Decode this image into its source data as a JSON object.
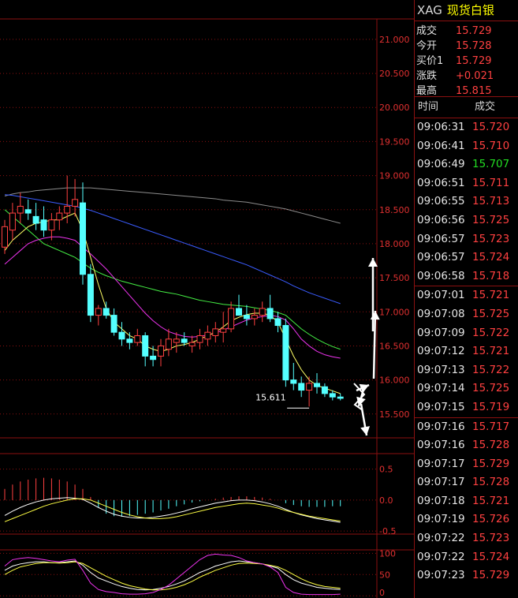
{
  "header": {
    "symbol": "XAG",
    "name": "现货白银"
  },
  "quote": [
    {
      "label": "成交",
      "value": "15.729"
    },
    {
      "label": "今开",
      "value": "15.728"
    },
    {
      "label": "买价1",
      "value": "15.729"
    },
    {
      "label": "涨跌",
      "value": "+0.021"
    },
    {
      "label": "最高",
      "value": "15.815"
    }
  ],
  "trades_header": {
    "time": "时间",
    "price": "成交"
  },
  "trades": [
    {
      "time": "09:06:31",
      "price": "15.720",
      "dir": "up"
    },
    {
      "time": "09:06:41",
      "price": "15.710",
      "dir": "up"
    },
    {
      "time": "09:06:49",
      "price": "15.707",
      "dir": "down"
    },
    {
      "time": "09:06:51",
      "price": "15.711",
      "dir": "up"
    },
    {
      "time": "09:06:55",
      "price": "15.713",
      "dir": "up"
    },
    {
      "time": "09:06:56",
      "price": "15.725",
      "dir": "up"
    },
    {
      "time": "09:06:57",
      "price": "15.723",
      "dir": "up"
    },
    {
      "time": "09:06:57",
      "price": "15.724",
      "dir": "up"
    },
    {
      "time": "09:06:58",
      "price": "15.718",
      "dir": "up"
    },
    {
      "time": "09:07:01",
      "price": "15.721",
      "dir": "up"
    },
    {
      "time": "09:07:08",
      "price": "15.725",
      "dir": "up"
    },
    {
      "time": "09:07:09",
      "price": "15.722",
      "dir": "up"
    },
    {
      "time": "09:07:12",
      "price": "15.721",
      "dir": "up"
    },
    {
      "time": "09:07:13",
      "price": "15.722",
      "dir": "up"
    },
    {
      "time": "09:07:14",
      "price": "15.725",
      "dir": "up"
    },
    {
      "time": "09:07:15",
      "price": "15.719",
      "dir": "up"
    },
    {
      "time": "09:07:16",
      "price": "15.717",
      "dir": "up"
    },
    {
      "time": "09:07:16",
      "price": "15.728",
      "dir": "up"
    },
    {
      "time": "09:07:17",
      "price": "15.729",
      "dir": "up"
    },
    {
      "time": "09:07:17",
      "price": "15.728",
      "dir": "up"
    },
    {
      "time": "09:07:18",
      "price": "15.721",
      "dir": "up"
    },
    {
      "time": "09:07:19",
      "price": "15.726",
      "dir": "up"
    },
    {
      "time": "09:07:22",
      "price": "15.723",
      "dir": "up"
    },
    {
      "time": "09:07:22",
      "price": "15.724",
      "dir": "up"
    },
    {
      "time": "09:07:23",
      "price": "15.729",
      "dir": "up"
    }
  ],
  "chart_data": {
    "type": "candlestick",
    "price_ticks": [
      "21.000",
      "20.500",
      "20.000",
      "19.500",
      "19.000",
      "18.500",
      "18.000",
      "17.500",
      "17.000",
      "16.500",
      "16.000",
      "15.500"
    ],
    "ylim": [
      15.15,
      21.3
    ],
    "low_annotation": "15.611",
    "candles": [
      {
        "o": 17.95,
        "h": 18.35,
        "l": 17.85,
        "c": 18.25
      },
      {
        "o": 18.2,
        "h": 18.6,
        "l": 18.05,
        "c": 18.45
      },
      {
        "o": 18.45,
        "h": 18.75,
        "l": 18.3,
        "c": 18.55
      },
      {
        "o": 18.5,
        "h": 18.65,
        "l": 18.35,
        "c": 18.45
      },
      {
        "o": 18.4,
        "h": 18.6,
        "l": 18.2,
        "c": 18.3
      },
      {
        "o": 18.35,
        "h": 18.55,
        "l": 18.1,
        "c": 18.2
      },
      {
        "o": 18.2,
        "h": 18.45,
        "l": 18.05,
        "c": 18.35
      },
      {
        "o": 18.35,
        "h": 18.55,
        "l": 18.2,
        "c": 18.45
      },
      {
        "o": 18.45,
        "h": 19.0,
        "l": 18.3,
        "c": 18.55
      },
      {
        "o": 18.55,
        "h": 18.95,
        "l": 18.4,
        "c": 18.65
      },
      {
        "o": 18.6,
        "h": 18.9,
        "l": 17.4,
        "c": 17.55
      },
      {
        "o": 17.55,
        "h": 17.7,
        "l": 16.85,
        "c": 16.95
      },
      {
        "o": 16.95,
        "h": 17.1,
        "l": 16.8,
        "c": 17.05
      },
      {
        "o": 17.05,
        "h": 17.15,
        "l": 16.9,
        "c": 16.95
      },
      {
        "o": 16.95,
        "h": 17.05,
        "l": 16.65,
        "c": 16.7
      },
      {
        "o": 16.7,
        "h": 16.85,
        "l": 16.5,
        "c": 16.6
      },
      {
        "o": 16.6,
        "h": 16.7,
        "l": 16.45,
        "c": 16.55
      },
      {
        "o": 16.55,
        "h": 16.75,
        "l": 16.5,
        "c": 16.65
      },
      {
        "o": 16.65,
        "h": 16.7,
        "l": 16.2,
        "c": 16.35
      },
      {
        "o": 16.35,
        "h": 16.5,
        "l": 16.2,
        "c": 16.3
      },
      {
        "o": 16.35,
        "h": 16.6,
        "l": 16.2,
        "c": 16.5
      },
      {
        "o": 16.45,
        "h": 16.75,
        "l": 16.35,
        "c": 16.6
      },
      {
        "o": 16.55,
        "h": 16.7,
        "l": 16.4,
        "c": 16.6
      },
      {
        "o": 16.6,
        "h": 16.7,
        "l": 16.5,
        "c": 16.55
      },
      {
        "o": 16.5,
        "h": 16.65,
        "l": 16.4,
        "c": 16.55
      },
      {
        "o": 16.55,
        "h": 16.75,
        "l": 16.45,
        "c": 16.65
      },
      {
        "o": 16.6,
        "h": 16.8,
        "l": 16.5,
        "c": 16.7
      },
      {
        "o": 16.65,
        "h": 16.85,
        "l": 16.55,
        "c": 16.75
      },
      {
        "o": 16.7,
        "h": 17.0,
        "l": 16.55,
        "c": 16.75
      },
      {
        "o": 16.75,
        "h": 17.15,
        "l": 16.7,
        "c": 17.05
      },
      {
        "o": 17.05,
        "h": 17.25,
        "l": 16.95,
        "c": 16.95
      },
      {
        "o": 16.95,
        "h": 17.1,
        "l": 16.8,
        "c": 16.9
      },
      {
        "o": 16.9,
        "h": 17.05,
        "l": 16.8,
        "c": 16.95
      },
      {
        "o": 16.95,
        "h": 17.15,
        "l": 16.85,
        "c": 17.05
      },
      {
        "o": 17.05,
        "h": 17.25,
        "l": 16.85,
        "c": 16.9
      },
      {
        "o": 16.9,
        "h": 17.0,
        "l": 16.7,
        "c": 16.8
      },
      {
        "o": 16.8,
        "h": 16.9,
        "l": 15.9,
        "c": 16.0
      },
      {
        "o": 16.0,
        "h": 16.25,
        "l": 15.85,
        "c": 15.95
      },
      {
        "o": 15.95,
        "h": 16.05,
        "l": 15.75,
        "c": 15.85
      },
      {
        "o": 15.85,
        "h": 16.05,
        "l": 15.61,
        "c": 15.95
      },
      {
        "o": 15.95,
        "h": 16.1,
        "l": 15.8,
        "c": 15.9
      },
      {
        "o": 15.9,
        "h": 15.95,
        "l": 15.75,
        "c": 15.8
      },
      {
        "o": 15.8,
        "h": 15.85,
        "l": 15.7,
        "c": 15.75
      },
      {
        "o": 15.75,
        "h": 15.8,
        "l": 15.7,
        "c": 15.73
      }
    ],
    "moving_averages": [
      {
        "color": "#ffffff",
        "values": [
          18.7,
          18.73,
          18.75,
          18.76,
          18.78,
          18.79,
          18.8,
          18.81,
          18.82,
          18.82,
          18.82,
          18.82,
          18.81,
          18.8,
          18.79,
          18.78,
          18.77,
          18.76,
          18.75,
          18.74,
          18.73,
          18.72,
          18.71,
          18.7,
          18.69,
          18.68,
          18.67,
          18.66,
          18.64,
          18.63,
          18.62,
          18.61,
          18.59,
          18.57,
          18.55,
          18.53,
          18.51,
          18.48,
          18.45,
          18.42,
          18.39,
          18.36,
          18.33,
          18.3
        ]
      },
      {
        "color": "#3a5cff",
        "values": [
          18.72,
          18.71,
          18.69,
          18.67,
          18.65,
          18.63,
          18.61,
          18.59,
          18.57,
          18.55,
          18.52,
          18.49,
          18.45,
          18.41,
          18.37,
          18.33,
          18.29,
          18.25,
          18.21,
          18.17,
          18.13,
          18.09,
          18.05,
          18.01,
          17.97,
          17.93,
          17.89,
          17.85,
          17.81,
          17.77,
          17.73,
          17.69,
          17.64,
          17.59,
          17.54,
          17.49,
          17.44,
          17.38,
          17.33,
          17.28,
          17.24,
          17.2,
          17.16,
          17.12
        ]
      },
      {
        "color": "#44ee44",
        "values": [
          18.5,
          18.4,
          18.3,
          18.2,
          18.1,
          18.0,
          17.95,
          17.9,
          17.85,
          17.8,
          17.72,
          17.64,
          17.58,
          17.53,
          17.49,
          17.45,
          17.42,
          17.39,
          17.36,
          17.33,
          17.3,
          17.28,
          17.26,
          17.23,
          17.2,
          17.17,
          17.15,
          17.13,
          17.11,
          17.1,
          17.09,
          17.08,
          17.06,
          17.04,
          17.02,
          16.99,
          16.95,
          16.85,
          16.75,
          16.67,
          16.6,
          16.54,
          16.49,
          16.45
        ]
      },
      {
        "color": "#ee33ee",
        "values": [
          17.7,
          17.8,
          17.9,
          18.0,
          18.05,
          18.08,
          18.1,
          18.1,
          18.08,
          18.05,
          17.95,
          17.85,
          17.74,
          17.63,
          17.5,
          17.37,
          17.24,
          17.11,
          16.98,
          16.87,
          16.78,
          16.71,
          16.67,
          16.64,
          16.63,
          16.64,
          16.66,
          16.69,
          16.73,
          16.78,
          16.83,
          16.88,
          16.91,
          16.93,
          16.95,
          16.93,
          16.88,
          16.75,
          16.6,
          16.5,
          16.42,
          16.37,
          16.34,
          16.32
        ]
      },
      {
        "color": "#ffff66",
        "values": [
          17.9,
          18.05,
          18.15,
          18.25,
          18.3,
          18.32,
          18.35,
          18.35,
          18.4,
          18.45,
          18.2,
          17.8,
          17.4,
          17.05,
          16.85,
          16.75,
          16.65,
          16.6,
          16.5,
          16.45,
          16.42,
          16.45,
          16.5,
          16.52,
          16.55,
          16.6,
          16.65,
          16.7,
          16.78,
          16.87,
          16.92,
          16.96,
          16.98,
          16.98,
          16.95,
          16.85,
          16.6,
          16.35,
          16.15,
          16.0,
          15.92,
          15.88,
          15.84,
          15.8
        ]
      }
    ],
    "macd_ticks": [
      "0.5",
      "0.0",
      "-0.5"
    ],
    "macd_ylim": [
      -0.55,
      0.75
    ],
    "macd_bars": [
      0.18,
      0.25,
      0.3,
      0.33,
      0.35,
      0.36,
      0.35,
      0.33,
      0.3,
      0.25,
      0.18,
      0.05,
      -0.12,
      -0.22,
      -0.26,
      -0.27,
      -0.26,
      -0.24,
      -0.22,
      -0.2,
      -0.17,
      -0.14,
      -0.1,
      -0.07,
      -0.04,
      -0.02,
      0.0,
      0.02,
      0.04,
      0.05,
      0.06,
      0.06,
      0.05,
      0.04,
      0.02,
      0.0,
      -0.05,
      -0.08,
      -0.1,
      -0.11,
      -0.11,
      -0.11,
      -0.1,
      -0.1
    ],
    "macd_lines": [
      {
        "color": "#ffffff",
        "values": [
          -0.25,
          -0.18,
          -0.12,
          -0.07,
          -0.03,
          0.0,
          0.02,
          0.03,
          0.04,
          0.03,
          0.01,
          -0.05,
          -0.12,
          -0.18,
          -0.23,
          -0.26,
          -0.28,
          -0.29,
          -0.29,
          -0.28,
          -0.26,
          -0.24,
          -0.21,
          -0.18,
          -0.14,
          -0.11,
          -0.08,
          -0.05,
          -0.03,
          -0.01,
          0.0,
          0.0,
          -0.01,
          -0.03,
          -0.06,
          -0.1,
          -0.15,
          -0.2,
          -0.24,
          -0.27,
          -0.3,
          -0.32,
          -0.34,
          -0.36
        ]
      },
      {
        "color": "#ffff44",
        "values": [
          -0.35,
          -0.3,
          -0.25,
          -0.2,
          -0.15,
          -0.1,
          -0.06,
          -0.03,
          0.0,
          0.02,
          0.02,
          0.0,
          -0.05,
          -0.1,
          -0.15,
          -0.2,
          -0.24,
          -0.27,
          -0.29,
          -0.3,
          -0.3,
          -0.29,
          -0.27,
          -0.24,
          -0.21,
          -0.18,
          -0.15,
          -0.12,
          -0.1,
          -0.08,
          -0.06,
          -0.05,
          -0.06,
          -0.08,
          -0.1,
          -0.13,
          -0.17,
          -0.2,
          -0.23,
          -0.26,
          -0.28,
          -0.3,
          -0.32,
          -0.34
        ]
      }
    ],
    "kdj_ticks": [
      "100",
      "50",
      "0"
    ],
    "kdj_ylim": [
      -5,
      108
    ],
    "kdj_lines": [
      {
        "color": "#ffffff",
        "values": [
          60,
          70,
          75,
          78,
          80,
          80,
          78,
          78,
          80,
          82,
          72,
          55,
          42,
          35,
          28,
          22,
          18,
          15,
          14,
          15,
          18,
          22,
          28,
          35,
          45,
          55,
          62,
          70,
          75,
          80,
          82,
          80,
          78,
          75,
          70,
          65,
          50,
          38,
          30,
          25,
          20,
          18,
          16,
          15
        ]
      },
      {
        "color": "#ffff44",
        "values": [
          50,
          60,
          68,
          72,
          76,
          78,
          78,
          77,
          78,
          80,
          76,
          66,
          56,
          46,
          38,
          30,
          24,
          20,
          16,
          14,
          14,
          16,
          20,
          26,
          34,
          44,
          52,
          60,
          66,
          72,
          76,
          77,
          76,
          75,
          72,
          68,
          60,
          50,
          40,
          32,
          26,
          22,
          20,
          18
        ]
      },
      {
        "color": "#ee33ee",
        "values": [
          70,
          85,
          88,
          90,
          88,
          85,
          82,
          80,
          84,
          86,
          60,
          30,
          15,
          10,
          8,
          5,
          4,
          4,
          5,
          8,
          15,
          25,
          40,
          55,
          70,
          85,
          95,
          98,
          96,
          95,
          90,
          82,
          78,
          75,
          68,
          55,
          20,
          8,
          4,
          3,
          3,
          3,
          3,
          4
        ]
      }
    ]
  }
}
